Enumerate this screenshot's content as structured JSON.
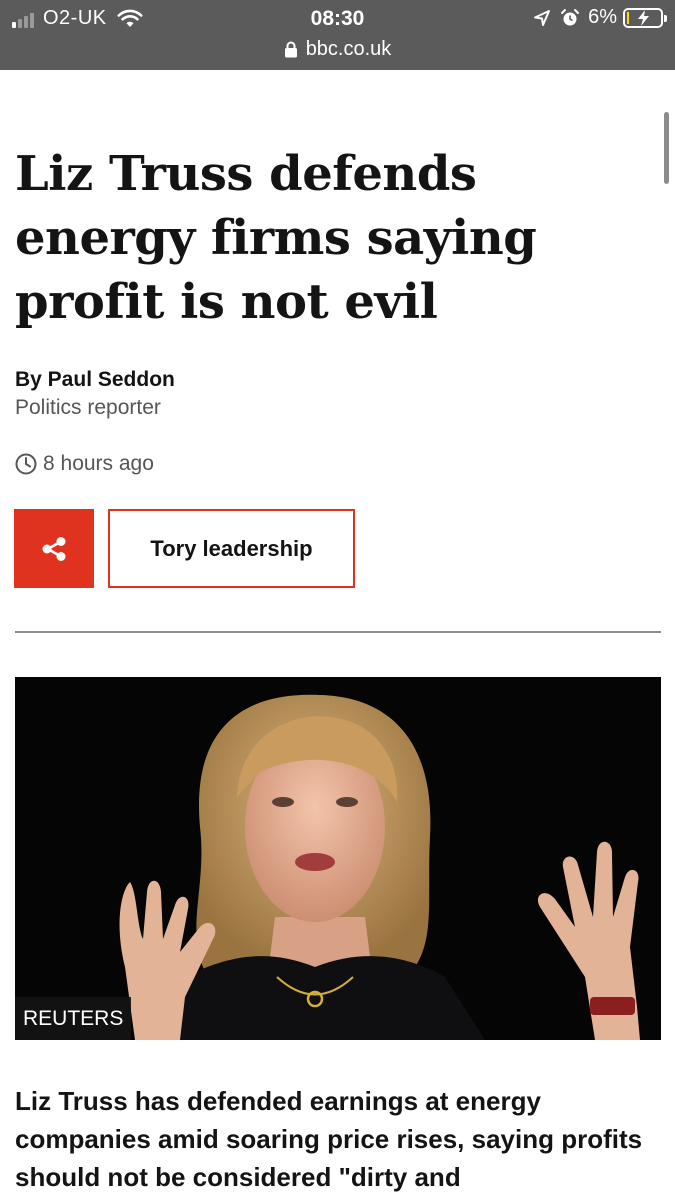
{
  "status_bar": {
    "carrier": "O2-UK",
    "time": "08:30",
    "battery_percent": "6%",
    "battery_level": 0.06,
    "url": "bbc.co.uk",
    "icons": [
      "signal-icon",
      "wifi-icon",
      "location-icon",
      "alarm-icon",
      "battery-icon",
      "lock-icon"
    ]
  },
  "article": {
    "headline": "Liz Truss defends energy firms saying profit is not evil",
    "author": "By Paul Seddon",
    "role": "Politics reporter",
    "timestamp": "8 hours ago",
    "topic_label": "Tory leadership",
    "image_credit": "REUTERS",
    "intro": "Liz Truss has defended earnings at energy companies amid soaring price rises, saying profits should not be considered \"dirty and"
  },
  "colors": {
    "bbc_red": "#e0331f",
    "status_bar_bg": "#5b5b5b",
    "text": "#141414",
    "muted_text": "#545658"
  }
}
